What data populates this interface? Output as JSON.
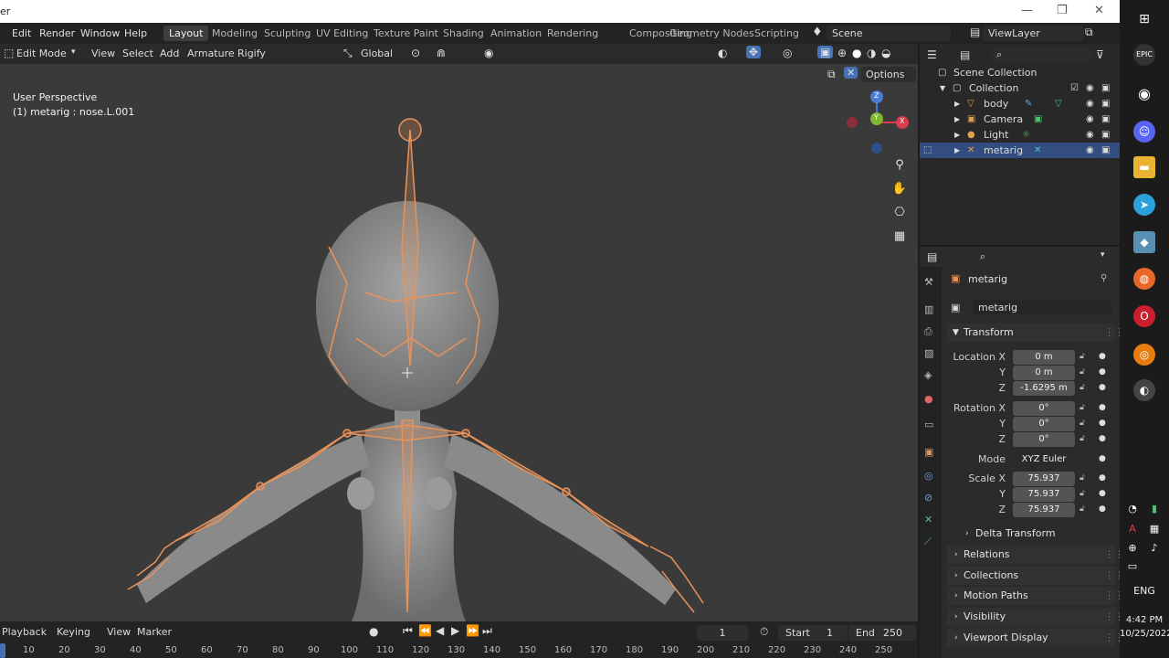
{
  "window": {
    "title": "er",
    "min": "—",
    "max": "❐",
    "close": "✕"
  },
  "menubar": {
    "items": [
      "Edit",
      "Render",
      "Window",
      "Help"
    ],
    "workspaces": [
      "Layout",
      "Modeling",
      "Sculpting",
      "UV Editing",
      "Texture Paint",
      "Shading",
      "Animation",
      "Rendering",
      "Compositing",
      "Geometry Nodes",
      "Scripting"
    ],
    "scene": "Scene",
    "view_layer": "ViewLayer"
  },
  "viewport_header": {
    "mode": "Edit Mode",
    "menus": [
      "View",
      "Select",
      "Add",
      "Armature",
      "Rigify"
    ],
    "orientation": "Global",
    "options": "Options"
  },
  "viewport": {
    "perspective": "User Perspective",
    "active": "(1) metarig : nose.L.001",
    "gizmo": {
      "z": "Z",
      "y": "Y",
      "x": "X"
    }
  },
  "outliner": {
    "rows": [
      {
        "label": "Scene Collection"
      },
      {
        "label": "Collection"
      },
      {
        "label": "body"
      },
      {
        "label": "Camera"
      },
      {
        "label": "Light"
      },
      {
        "label": "metarig"
      }
    ]
  },
  "properties": {
    "object_name": "metarig",
    "data_name": "metarig",
    "transform": {
      "title": "Transform",
      "location_label": "Location X",
      "location": [
        "0 m",
        "0 m",
        "-1.6295 m"
      ],
      "rotation_label": "Rotation X",
      "rotation": [
        "0°",
        "0°",
        "0°"
      ],
      "mode_label": "Mode",
      "mode_value": "XYZ Euler",
      "scale_label": "Scale X",
      "scale": [
        "75.937",
        "75.937",
        "75.937"
      ],
      "y": "Y",
      "z": "Z"
    },
    "panels": [
      "Delta Transform",
      "Relations",
      "Collections",
      "Motion Paths",
      "Visibility",
      "Viewport Display"
    ]
  },
  "timeline": {
    "menus": [
      "Playback",
      "Keying",
      "View",
      "Marker"
    ],
    "current_frame": "1",
    "start_label": "Start",
    "start": "1",
    "end_label": "End",
    "end": "250",
    "ruler": [
      "10",
      "20",
      "30",
      "40",
      "50",
      "60",
      "70",
      "80",
      "90",
      "100",
      "110",
      "120",
      "130",
      "140",
      "150",
      "160",
      "170",
      "180",
      "190",
      "200",
      "210",
      "220",
      "230",
      "240",
      "250"
    ]
  },
  "taskbar": {
    "lang": "ENG",
    "time": "4:42 PM",
    "date": "10/25/2022"
  },
  "colors": {
    "accent": "#4772b3",
    "selection": "#334d80",
    "bone": "#e8935a"
  }
}
